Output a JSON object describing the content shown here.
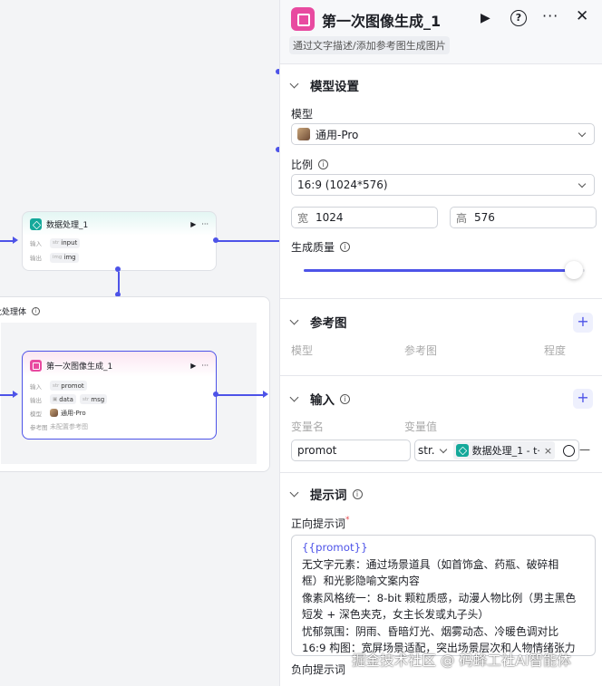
{
  "canvas": {
    "node_data": {
      "title": "数据处理_1",
      "input_label": "输入",
      "input_type": "str",
      "input_value": "input",
      "output_label": "输出",
      "output_type": "img",
      "output_value": "img"
    },
    "batch": {
      "title": "批处理体",
      "info_icon": "info-icon"
    },
    "node_image": {
      "title": "第一次图像生成_1",
      "input_label": "输入",
      "input_type": "str",
      "input_value": "promot",
      "output_label": "输出",
      "output_value_1": "data",
      "output_type_2": "str",
      "output_value_2": "msg",
      "model_label": "模型",
      "model_value": "通用-Pro",
      "ref_label": "参考图",
      "ref_value": "未配置参考图"
    },
    "edge_color": "#4d53e8"
  },
  "panel": {
    "title": "第一次图像生成_1",
    "description": "通过文字描述/添加参考图生成图片",
    "sections": {
      "model": {
        "title": "模型设置",
        "model_label": "模型",
        "model_value": "通用-Pro",
        "ratio_label": "比例",
        "ratio_value": "16:9 (1024*576)",
        "width_label": "宽",
        "width_value": "1024",
        "height_label": "高",
        "height_value": "576",
        "quality_label": "生成质量",
        "quality_fraction": 0.96
      },
      "reference": {
        "title": "参考图",
        "col_model": "模型",
        "col_ref": "参考图",
        "col_degree": "程度"
      },
      "input": {
        "title": "输入",
        "col_name": "变量名",
        "col_value": "变量值",
        "var_name": "promot",
        "var_type": "str.",
        "var_ref": "数据处理_1 - t·",
        "remove": "—"
      },
      "prompt": {
        "title": "提示词",
        "positive_label": "正向提示词",
        "required_mark": "*",
        "lines": [
          "{{promot}}",
          "无文字元素：通过场景道具（如首饰盒、药瓶、破碎相",
          "框）和光影隐喻文案内容",
          "像素风格统一：8-bit 颗粒质感，动漫人物比例（男主黑色",
          "短发 + 深色夹克，女主长发或丸子头）",
          "忧郁氛围：阴雨、昏暗灯光、烟雾动态、冷暖色调对比",
          "16:9 构图：宽屏场景适配，突出场景层次和人物情绪张力"
        ],
        "negative_label": "负向提示词"
      }
    },
    "accent_color": "#4d53e8"
  },
  "watermark": "掘金技术社区 @ 码蜂工社AI智能体"
}
